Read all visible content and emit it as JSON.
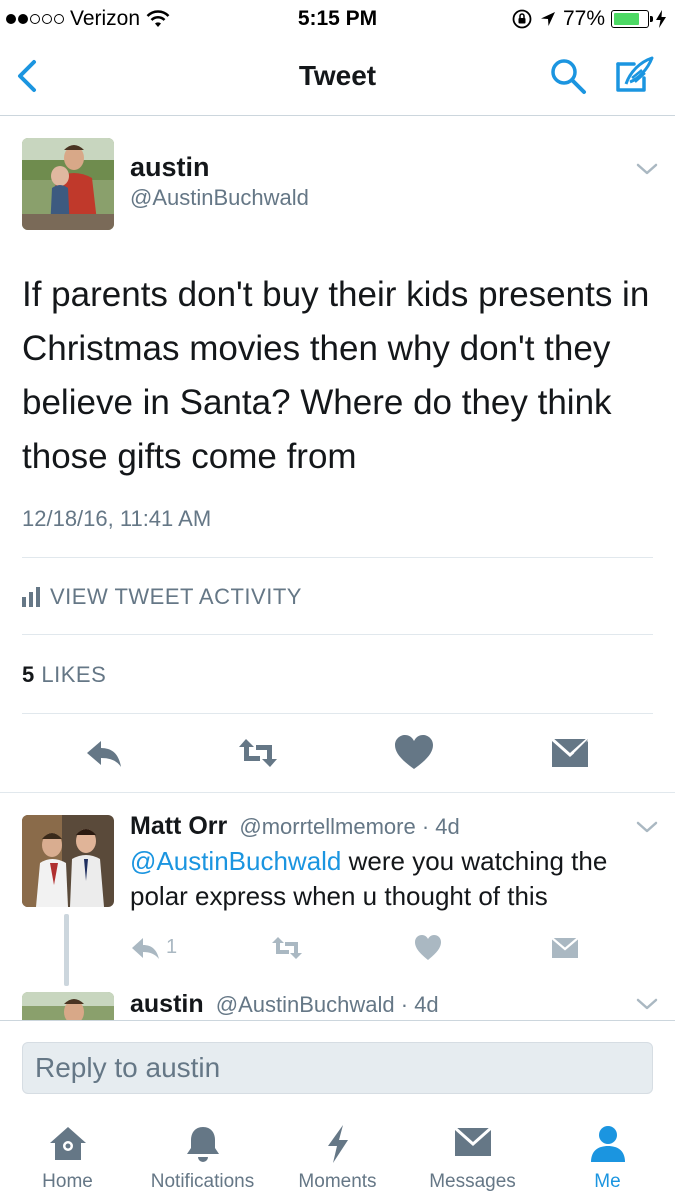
{
  "status_bar": {
    "carrier": "Verizon",
    "time": "5:15 PM",
    "battery": "77%",
    "battery_level": 0.77
  },
  "nav": {
    "title": "Tweet",
    "back_icon": "chevron-left-icon",
    "search_icon": "search-icon",
    "compose_icon": "compose-icon"
  },
  "tweet": {
    "name": "austin",
    "handle": "@AustinBuchwald",
    "text": "If parents don't buy their kids presents in Christmas movies then why don't they believe in Santa? Where do they think those gifts come from",
    "timestamp": "12/18/16, 11:41 AM",
    "activity_label": "VIEW TWEET ACTIVITY",
    "likes_count": "5",
    "likes_label": "LIKES"
  },
  "replies": [
    {
      "name": "Matt Orr",
      "handle": "@morrtellmemore",
      "age": "· 4d",
      "mention": "@AustinBuchwald",
      "text": " were you watching the polar express when u thought of this",
      "reply_count": "1"
    },
    {
      "name": "austin",
      "handle": "@AustinBuchwald",
      "age": "· 4d"
    }
  ],
  "reply_box": {
    "placeholder": "Reply to austin"
  },
  "tabs": [
    {
      "label": "Home",
      "icon": "home-icon"
    },
    {
      "label": "Notifications",
      "icon": "bell-icon"
    },
    {
      "label": "Moments",
      "icon": "lightning-icon"
    },
    {
      "label": "Messages",
      "icon": "envelope-icon"
    },
    {
      "label": "Me",
      "icon": "person-icon",
      "active": true
    }
  ],
  "colors": {
    "accent": "#1b95e0",
    "text_primary": "#14171a",
    "text_secondary": "#657786",
    "icon_gray": "#657786",
    "icon_light": "#aab8c2",
    "divider": "#e1e8ed"
  }
}
